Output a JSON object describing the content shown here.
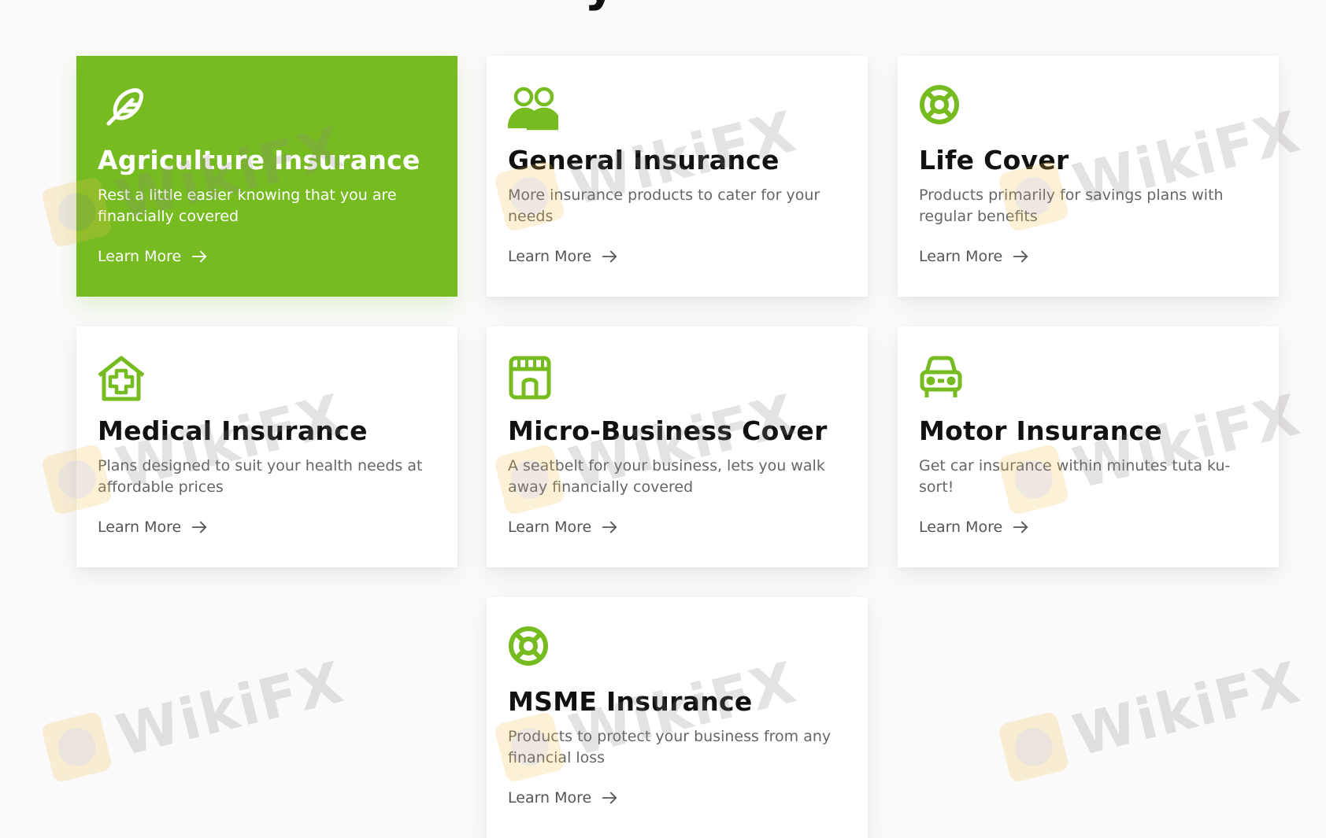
{
  "section": {
    "heading_fragment": "y"
  },
  "brand": {
    "accent_color": "#76bc21"
  },
  "watermark": {
    "text": "WikiFX"
  },
  "cards": [
    {
      "title": "Agriculture Insurance",
      "description": "Rest a little easier knowing that you are financially covered",
      "link_label": "Learn More",
      "icon": "feather-icon",
      "active": true
    },
    {
      "title": "General Insurance",
      "description": "More insurance products to cater for your needs",
      "link_label": "Learn More",
      "icon": "users-icon",
      "active": false
    },
    {
      "title": "Life Cover",
      "description": "Products primarily for savings plans with regular benefits",
      "link_label": "Learn More",
      "icon": "lifebuoy-icon",
      "active": false
    },
    {
      "title": "Medical Insurance",
      "description": "Plans designed to suit your health needs at affordable prices",
      "link_label": "Learn More",
      "icon": "clinic-icon",
      "active": false
    },
    {
      "title": "Micro-Business Cover",
      "description": "A seatbelt for your business, lets you walk away financially covered",
      "link_label": "Learn More",
      "icon": "store-icon",
      "active": false
    },
    {
      "title": "Motor Insurance",
      "description": "Get car insurance within minutes tuta ku-sort!",
      "link_label": "Learn More",
      "icon": "car-icon",
      "active": false
    },
    {
      "title": "MSME Insurance",
      "description": "Products to protect your business from any financial loss",
      "link_label": "Learn More",
      "icon": "lifebuoy-icon",
      "active": false
    }
  ]
}
